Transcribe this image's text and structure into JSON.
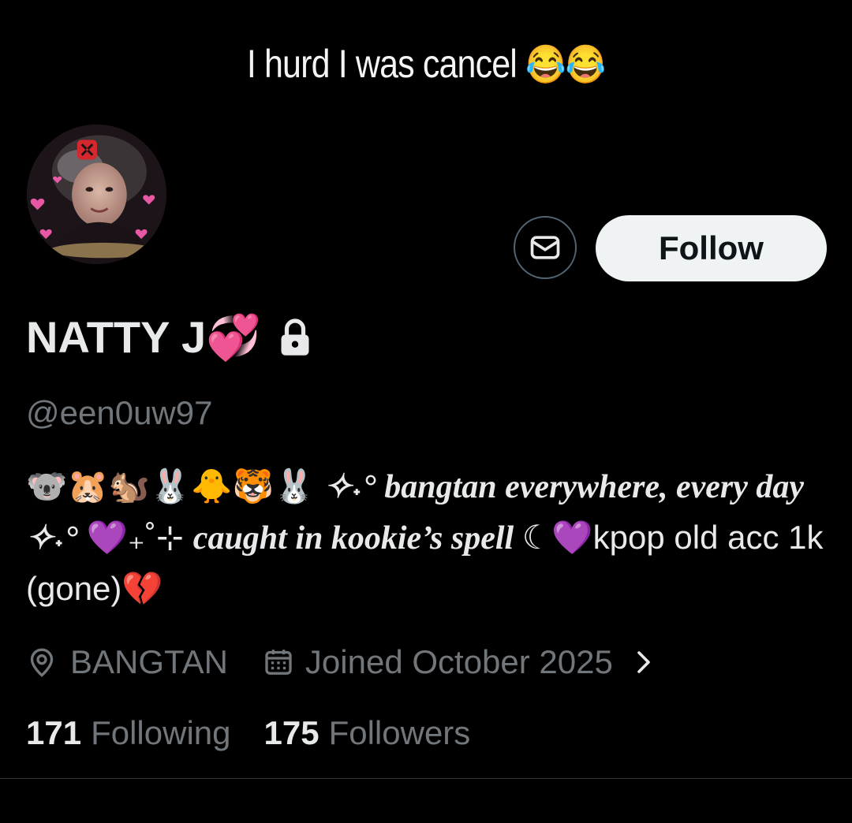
{
  "banner": {
    "text": "I hurd I was cancel",
    "emoji": "😂😂"
  },
  "actions": {
    "follow_label": "Follow",
    "message_icon": "envelope-icon"
  },
  "profile": {
    "display_name": "NATTY J💞",
    "protected_icon": "lock-icon",
    "handle": "@een0uw97"
  },
  "bio": {
    "emojis": "🐨🐹🐿️🐰🐥🐯🐰 ",
    "part1": "✧˖° bangtan everywhere, every day ✧˖° ",
    "heart1": "💜₊˚⊹ ",
    "part2": "caught in kookie’s spell ",
    "part3": "☾💜kpop old acc 1k (gone)💔"
  },
  "meta": {
    "location": "BANGTAN",
    "joined": "Joined October 2025",
    "location_icon": "location-pin-icon",
    "calendar_icon": "calendar-icon",
    "chevron_icon": "chevron-right-icon"
  },
  "stats": {
    "following_count": "171",
    "following_label": "Following",
    "followers_count": "175",
    "followers_label": "Followers"
  },
  "colors": {
    "background": "#000000",
    "primary_text": "#e7e9ea",
    "secondary_text": "#71767b",
    "follow_button_bg": "#eff3f4",
    "border": "#2f3336"
  }
}
